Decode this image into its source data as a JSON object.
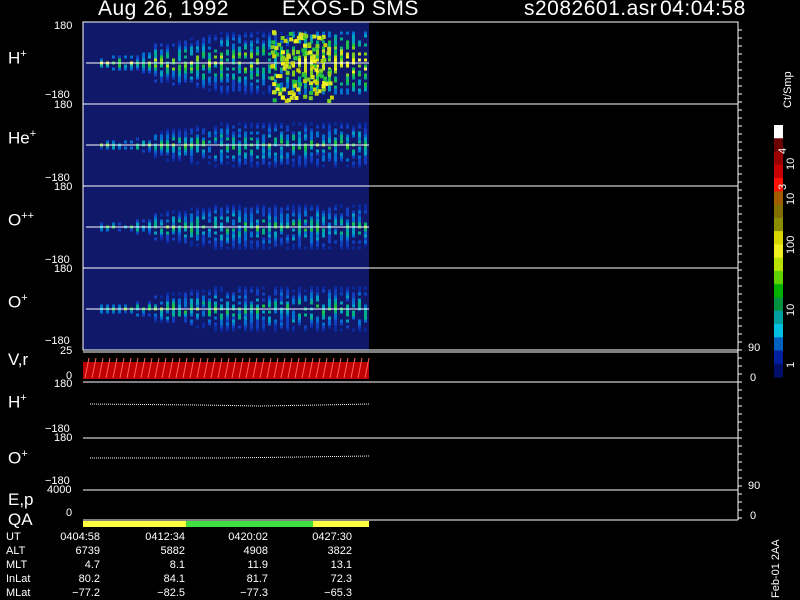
{
  "header": {
    "date": "Aug 26, 1992",
    "instrument": "EXOS-D SMS",
    "file": "s2082601.asr",
    "time": "04:04:58"
  },
  "panels": [
    {
      "label": "H",
      "sup": "+",
      "top_tick": "180",
      "bottom_tick": "−180"
    },
    {
      "label": "He",
      "sup": "+",
      "top_tick": "180",
      "bottom_tick": "−180"
    },
    {
      "label": "O",
      "sup": "++",
      "top_tick": "180",
      "bottom_tick": "−180"
    },
    {
      "label": "O",
      "sup": "+",
      "top_tick": "180",
      "bottom_tick": "−180"
    }
  ],
  "vr_panel": {
    "label": "V,r",
    "top_tick": "25",
    "bottom_tick": "0",
    "right_top": "90",
    "right_bottom": "0"
  },
  "hplus_line_panel": {
    "label": "H",
    "sup": "+",
    "top_tick": "180",
    "bottom_tick": "−180"
  },
  "oplus_line_panel": {
    "label": "O",
    "sup": "+",
    "top_tick": "180",
    "bottom_tick": "−180"
  },
  "ep_panel": {
    "label": "E,p",
    "top_tick": "4000",
    "bottom_tick": "0",
    "right_top": "90",
    "right_bottom": "0"
  },
  "qa_panel": {
    "label": "QA"
  },
  "colorbar": {
    "unit_label": "Ct/Smp",
    "tick_labels": [
      "10",
      "4",
      "10",
      "3",
      "100",
      "10",
      "1"
    ],
    "colors": [
      "#ffffff",
      "#6b0000",
      "#9a0000",
      "#c80000",
      "#ff1000",
      "#a05a00",
      "#806f00",
      "#8c8c00",
      "#d8d800",
      "#f0f020",
      "#b8e000",
      "#60d000",
      "#00b000",
      "#009040",
      "#00a0a0",
      "#00c0e0",
      "#0060c0",
      "#0020a0",
      "#00106a"
    ]
  },
  "qa_bar": [
    {
      "color": "#ffff40",
      "from_min": 0.0,
      "to_min": 8.3
    },
    {
      "color": "#40e040",
      "from_min": 8.3,
      "to_min": 18.5
    },
    {
      "color": "#ffff40",
      "from_min": 18.5,
      "to_min": 23.0
    }
  ],
  "ephemeris": {
    "labels": [
      "UT",
      "ALT",
      "MLT",
      "InLat",
      "MLat"
    ],
    "columns": [
      [
        "0404:58",
        "6739",
        "4.7",
        "80.2",
        "−77.2"
      ],
      [
        "0412:34",
        "5882",
        "8.1",
        "84.1",
        "−82.5"
      ],
      [
        "0420:02",
        "4908",
        "11.9",
        "81.7",
        "−77.3"
      ],
      [
        "0427:30",
        "3822",
        "13.1",
        "72.3",
        "−65.3"
      ]
    ]
  },
  "footer_rot": "Feb-01 2AA",
  "chart_data": {
    "type": "heatmap",
    "title": "Aug 26, 1992   EXOS-D SMS",
    "panels": [
      "H+",
      "He+",
      "O++",
      "O+"
    ],
    "x_ut_ticks": [
      "0404:58",
      "0412:34",
      "0420:02",
      "0427:30"
    ],
    "ylim": [
      -180,
      180
    ],
    "colorbar_range": [
      1,
      10000
    ],
    "vr_ylim": [
      0,
      25
    ],
    "ep_ylim": [
      0,
      4000
    ]
  }
}
